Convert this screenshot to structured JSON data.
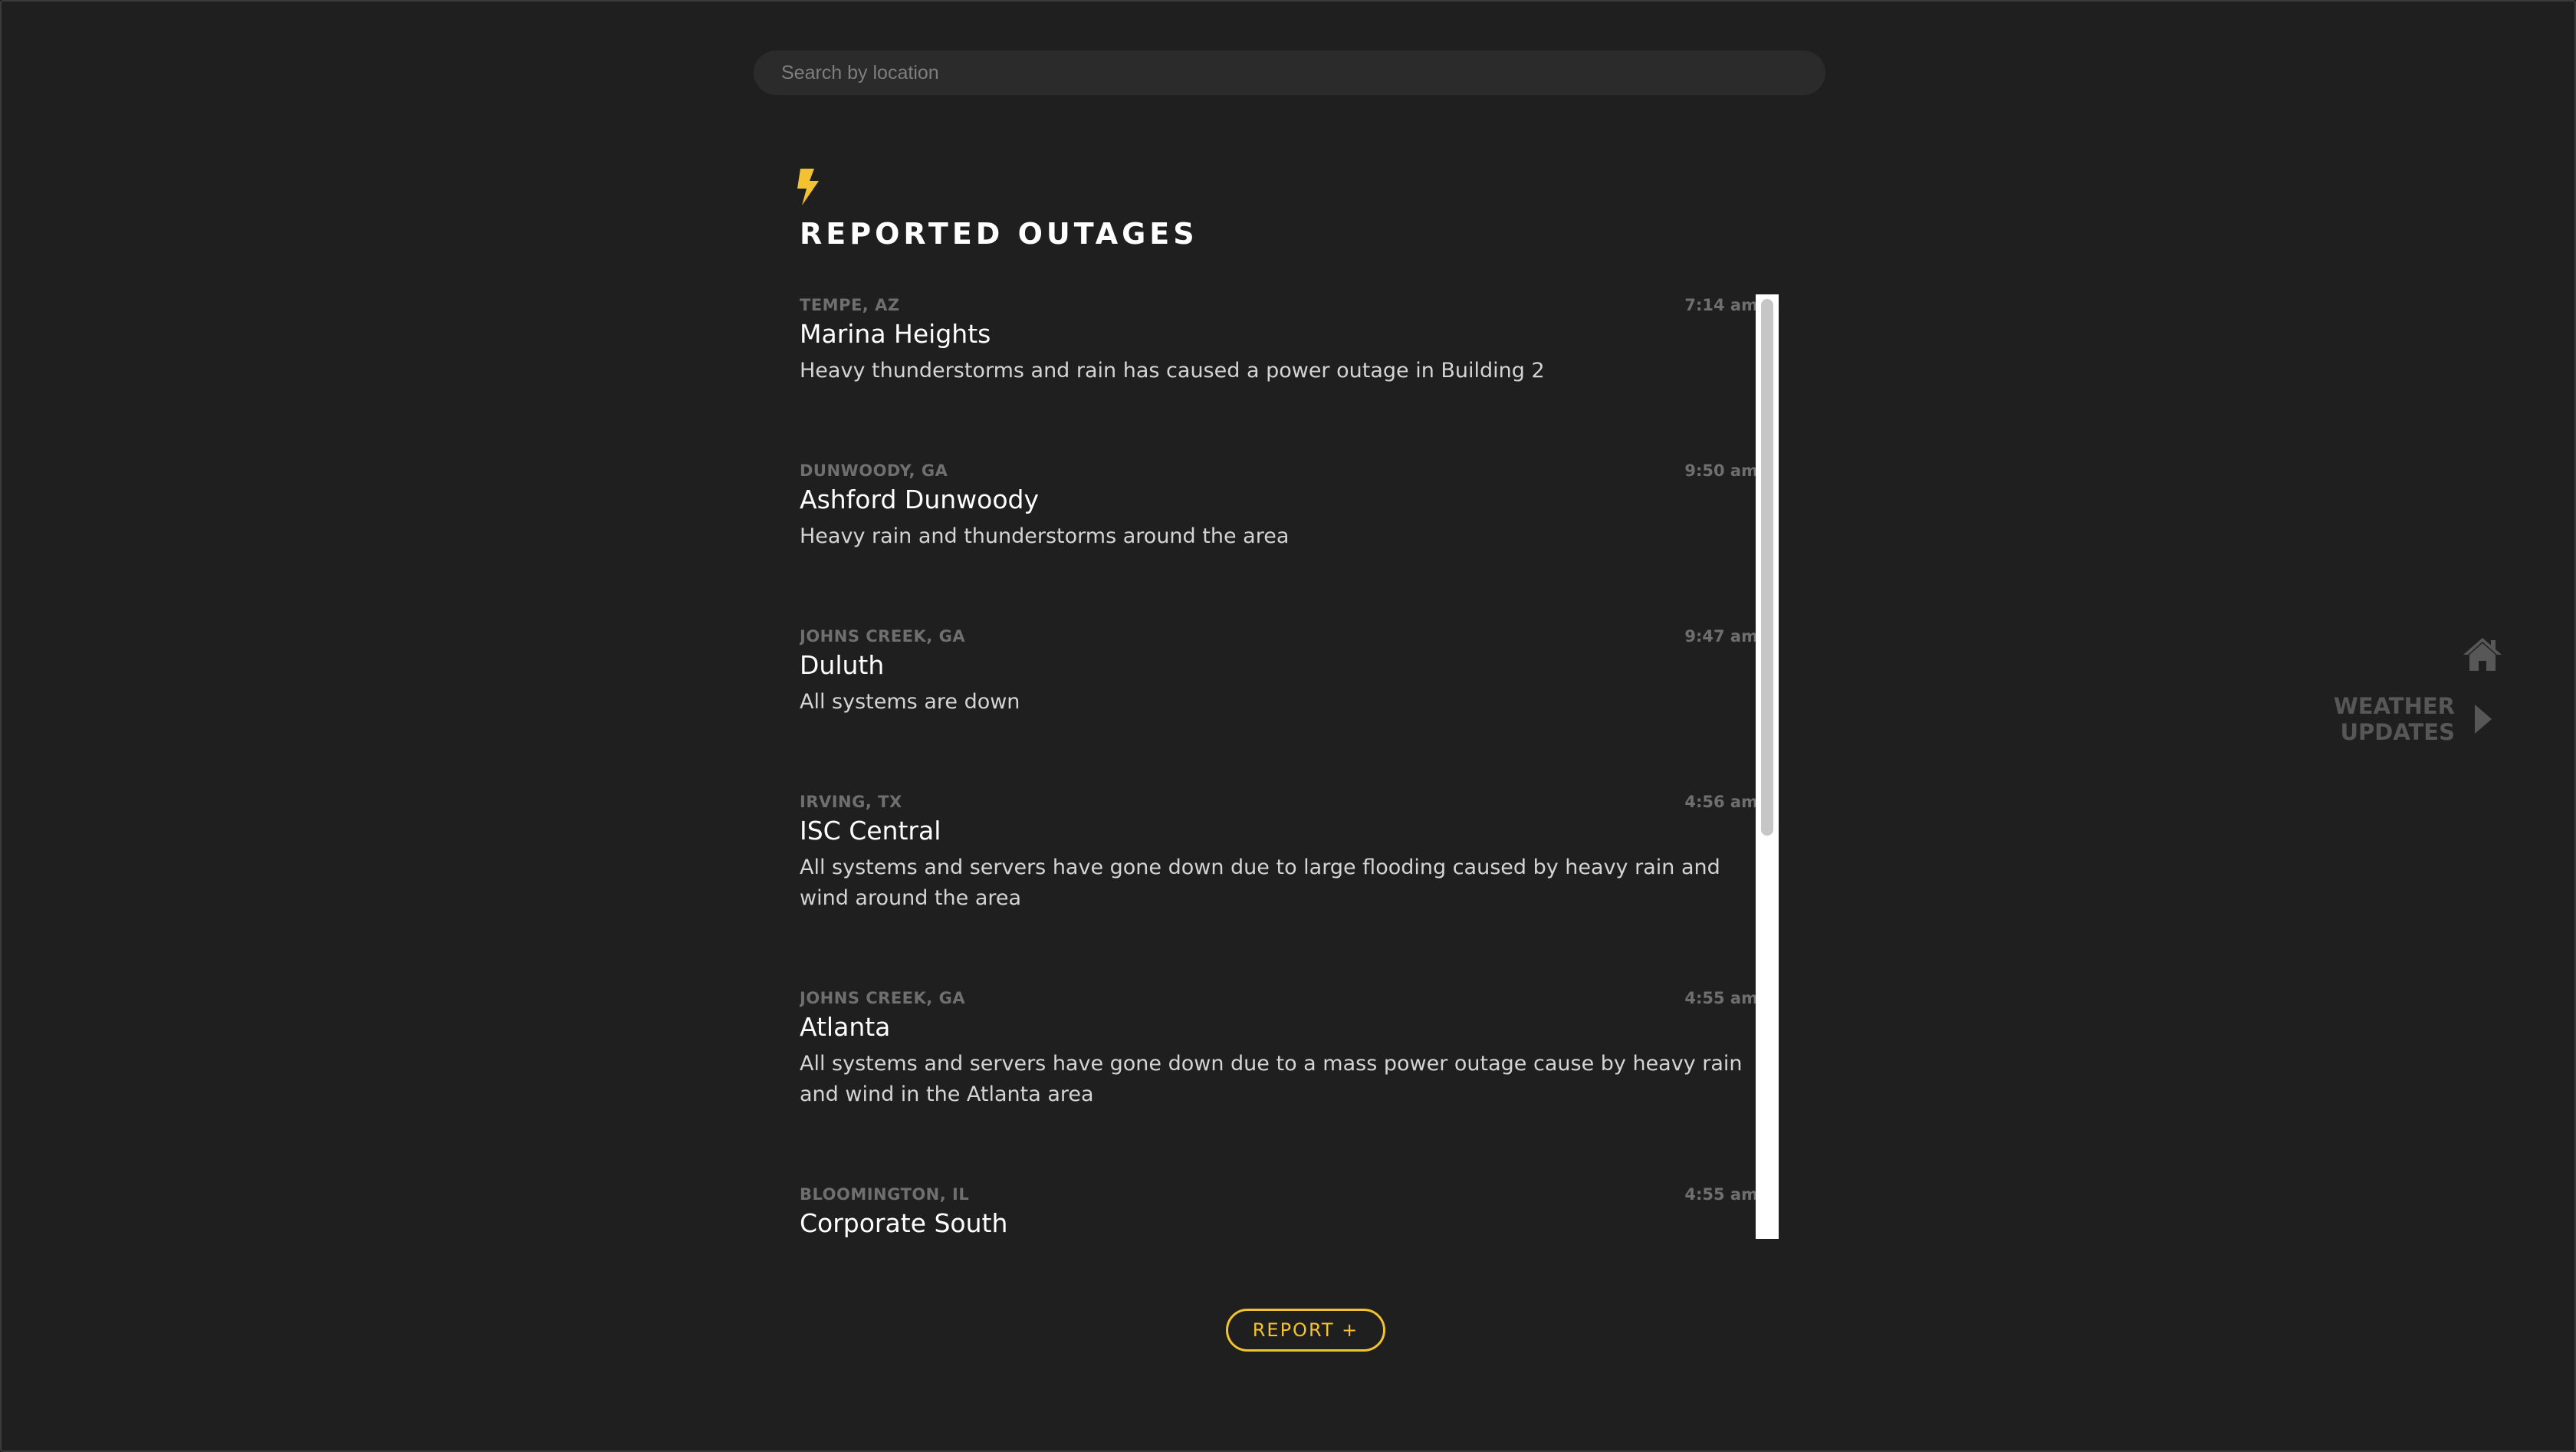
{
  "search": {
    "placeholder": "Search by location",
    "value": ""
  },
  "header": {
    "title": "REPORTED OUTAGES",
    "icon": "lightning-bolt-icon",
    "accent_color": "#f2c230"
  },
  "outages": [
    {
      "location": "TEMPE, AZ",
      "time": "7:14 am",
      "name": "Marina Heights",
      "description": "Heavy thunderstorms and rain has caused a power outage in Building 2"
    },
    {
      "location": "DUNWOODY, GA",
      "time": "9:50 am",
      "name": "Ashford Dunwoody",
      "description": "Heavy rain and thunderstorms around the area"
    },
    {
      "location": "JOHNS CREEK, GA",
      "time": "9:47 am",
      "name": "Duluth",
      "description": "All systems are down"
    },
    {
      "location": "IRVING, TX",
      "time": "4:56 am",
      "name": "ISC Central",
      "description": "All systems and servers have gone down due to large flooding caused by heavy rain and wind around the area"
    },
    {
      "location": "JOHNS CREEK, GA",
      "time": "4:55 am",
      "name": "Atlanta",
      "description": "All systems and servers have gone down due to a mass power outage cause by heavy rain and wind in the Atlanta area"
    },
    {
      "location": "BLOOMINGTON, IL",
      "time": "4:55 am",
      "name": "Corporate South",
      "description": ""
    }
  ],
  "report_button": {
    "label": "REPORT +"
  },
  "side_nav": {
    "home_icon": "home-icon",
    "weather_line1": "WEATHER",
    "weather_line2": "UPDATES",
    "weather_icon": "play-triangle-icon"
  }
}
